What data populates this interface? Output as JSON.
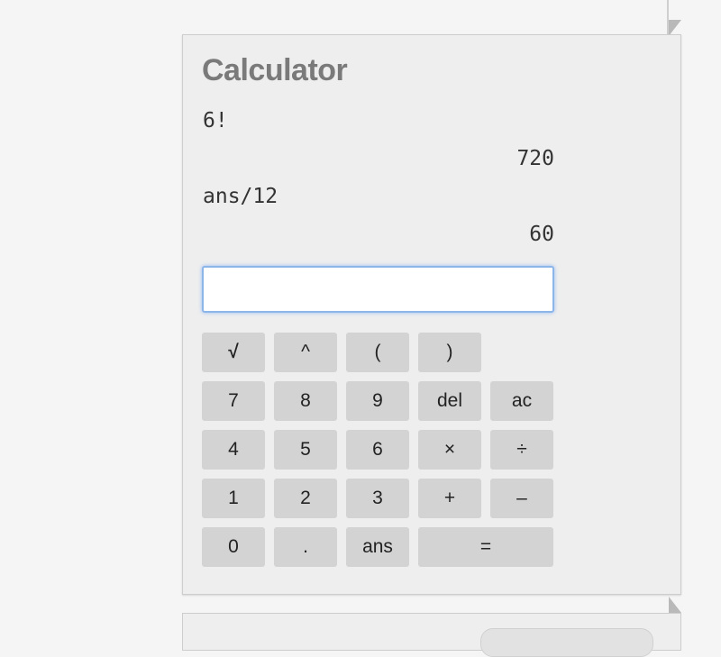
{
  "calculator": {
    "title": "Calculator",
    "history": [
      {
        "expression": "6!",
        "result": "720"
      },
      {
        "expression": "ans/12",
        "result": "60"
      }
    ],
    "input_value": "",
    "keys": {
      "sqrt": "√",
      "power": "^",
      "open_paren": "(",
      "close_paren": ")",
      "seven": "7",
      "eight": "8",
      "nine": "9",
      "delete": "del",
      "all_clear": "ac",
      "four": "4",
      "five": "5",
      "six": "6",
      "multiply": "×",
      "divide": "÷",
      "one": "1",
      "two": "2",
      "three": "3",
      "plus": "+",
      "minus": "–",
      "zero": "0",
      "decimal": ".",
      "ans": "ans",
      "equals": "="
    }
  },
  "colors": {
    "page_background": "#f5f5f5",
    "card_background": "#eeeeee",
    "key_background": "#d3d3d3",
    "title_color": "#7a7a7a",
    "input_focus_border": "#8db6e8"
  }
}
